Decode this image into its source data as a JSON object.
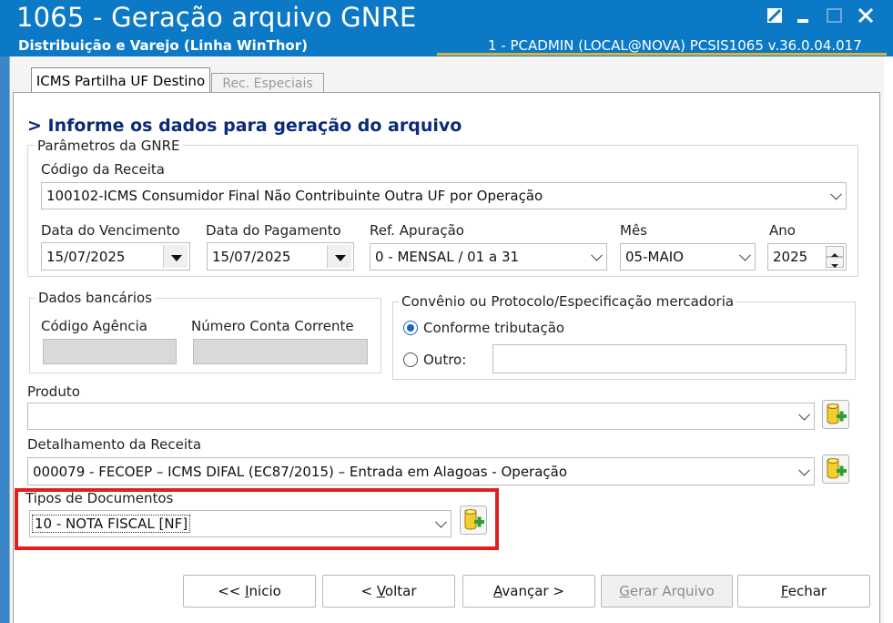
{
  "window": {
    "title": "1065 - Geração arquivo GNRE",
    "subtitle": "Distribuição e Varejo (Linha WinThor)",
    "user_info": "1 - PCADMIN (LOCAL@NOVA)   PCSIS1065  v.36.0.04.017"
  },
  "tabs": [
    {
      "label": "ICMS Partilha UF Destino",
      "active": true
    },
    {
      "label": "Rec. Especiais",
      "active": false
    }
  ],
  "section_title": "> Informe os dados para geração do arquivo",
  "parametros": {
    "legend": "Parâmetros da GNRE",
    "codigo_receita_label": "Código da Receita",
    "codigo_receita_value": "100102-ICMS Consumidor Final Não Contribuinte Outra UF por Operação",
    "data_vencimento_label": "Data do Vencimento",
    "data_vencimento_value": "15/07/2025",
    "data_pagamento_label": "Data do Pagamento",
    "data_pagamento_value": "15/07/2025",
    "ref_apuracao_label": "Ref. Apuração",
    "ref_apuracao_value": "0 - MENSAL / 01 a 31",
    "mes_label": "Mês",
    "mes_value": "05-MAIO",
    "ano_label": "Ano",
    "ano_value": "2025"
  },
  "dados_bancarios": {
    "legend": "Dados bancários",
    "agencia_label": "Código Agência",
    "conta_label": "Número Conta Corrente"
  },
  "convenio": {
    "legend": "Convênio ou Protocolo/Especificação mercadoria",
    "option1": "Conforme tributação",
    "option2": "Outro:",
    "selected": "Conforme tributação"
  },
  "produto": {
    "label": "Produto",
    "value": ""
  },
  "detalhamento": {
    "label": "Detalhamento da Receita",
    "value": "000079 - FECOEP – ICMS DIFAL (EC87/2015) – Entrada em Alagoas - Operação"
  },
  "tipos_documentos": {
    "label": "Tipos de Documentos",
    "value": "10 - NOTA FISCAL [NF]"
  },
  "buttons": {
    "inicio_prefix": "<< ",
    "inicio_key": "I",
    "inicio_rest": "nicio",
    "voltar_prefix": "< ",
    "voltar_key": "V",
    "voltar_rest": "oltar",
    "avancar_key": "A",
    "avancar_rest": "vançar >",
    "gerar_key": "G",
    "gerar_rest": "erar Arquivo",
    "fechar_key": "F",
    "fechar_rest": "echar"
  },
  "colors": {
    "title_bar": "#0c79c6",
    "section_title": "#0a2a7a",
    "highlight": "#e02020",
    "radio_selected": "#1a66c2"
  },
  "icons": [
    "restore-icon",
    "minimize-icon",
    "maximize-icon",
    "close-icon",
    "add-folder-icon"
  ]
}
